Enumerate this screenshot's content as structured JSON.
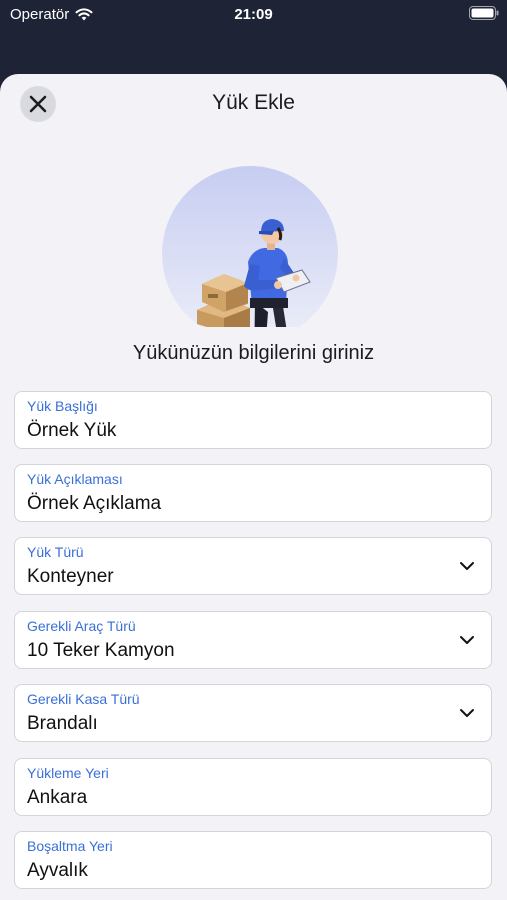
{
  "status_bar": {
    "carrier": "Operatör",
    "time": "21:09"
  },
  "header": {
    "title": "Yük Ekle"
  },
  "subtitle": "Yükünüzün bilgilerini giriniz",
  "fields": [
    {
      "label": "Yük Başlığı",
      "value": "Örnek Yük",
      "dropdown": false
    },
    {
      "label": "Yük Açıklaması",
      "value": "Örnek Açıklama",
      "dropdown": false
    },
    {
      "label": "Yük Türü",
      "value": "Konteyner",
      "dropdown": true
    },
    {
      "label": "Gerekli Araç Türü",
      "value": "10 Teker Kamyon",
      "dropdown": true
    },
    {
      "label": "Gerekli Kasa Türü",
      "value": "Brandalı",
      "dropdown": true
    },
    {
      "label": "Yükleme Yeri",
      "value": "Ankara",
      "dropdown": false
    },
    {
      "label": "Boşaltma Yeri",
      "value": "Ayvalık",
      "dropdown": false
    }
  ],
  "colors": {
    "accent": "#3a6fd8",
    "background": "#1e2436",
    "sheet": "#f2f2f7"
  },
  "icons": {
    "close": "close-icon",
    "chevron": "chevron-down-icon",
    "wifi": "wifi-icon",
    "battery": "battery-icon"
  }
}
